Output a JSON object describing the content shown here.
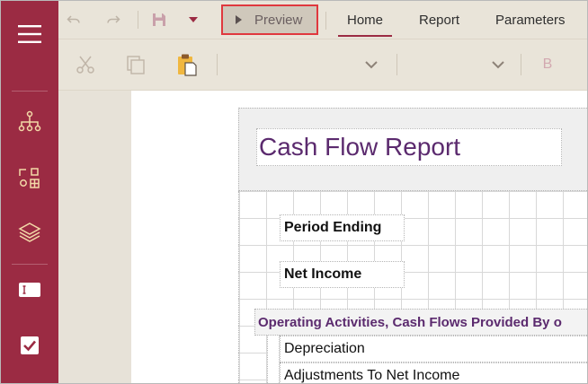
{
  "sidebar": {
    "color": "#9b2b43",
    "items": [
      {
        "icon": "hamburger-menu-icon"
      },
      {
        "icon": "hierarchy-tree-icon"
      },
      {
        "icon": "toolbox-components-icon"
      },
      {
        "icon": "layers-icon"
      },
      {
        "icon": "text-field-icon"
      },
      {
        "icon": "checkbox-icon"
      }
    ]
  },
  "topbar": {
    "undo_icon": "undo-icon",
    "redo_icon": "redo-icon",
    "save_icon": "save-icon",
    "save_dropdown_icon": "caret-down-icon",
    "preview_label": "Preview",
    "tabs": [
      {
        "label": "Home",
        "active": true
      },
      {
        "label": "Report",
        "active": false
      },
      {
        "label": "Parameters",
        "active": false
      }
    ]
  },
  "toolbar": {
    "cut_icon": "cut-icon",
    "copy_icon": "copy-icon",
    "paste_icon": "paste-icon",
    "dropdown_icon": "chevron-down-icon",
    "bold_label": "B"
  },
  "report": {
    "title": "Cash Flow Report",
    "period_label": "Period Ending",
    "net_income_label": "Net Income",
    "section_label": "Operating Activities, Cash Flows Provided By o",
    "rows": [
      "Depreciation",
      "Adjustments To Net Income"
    ]
  }
}
